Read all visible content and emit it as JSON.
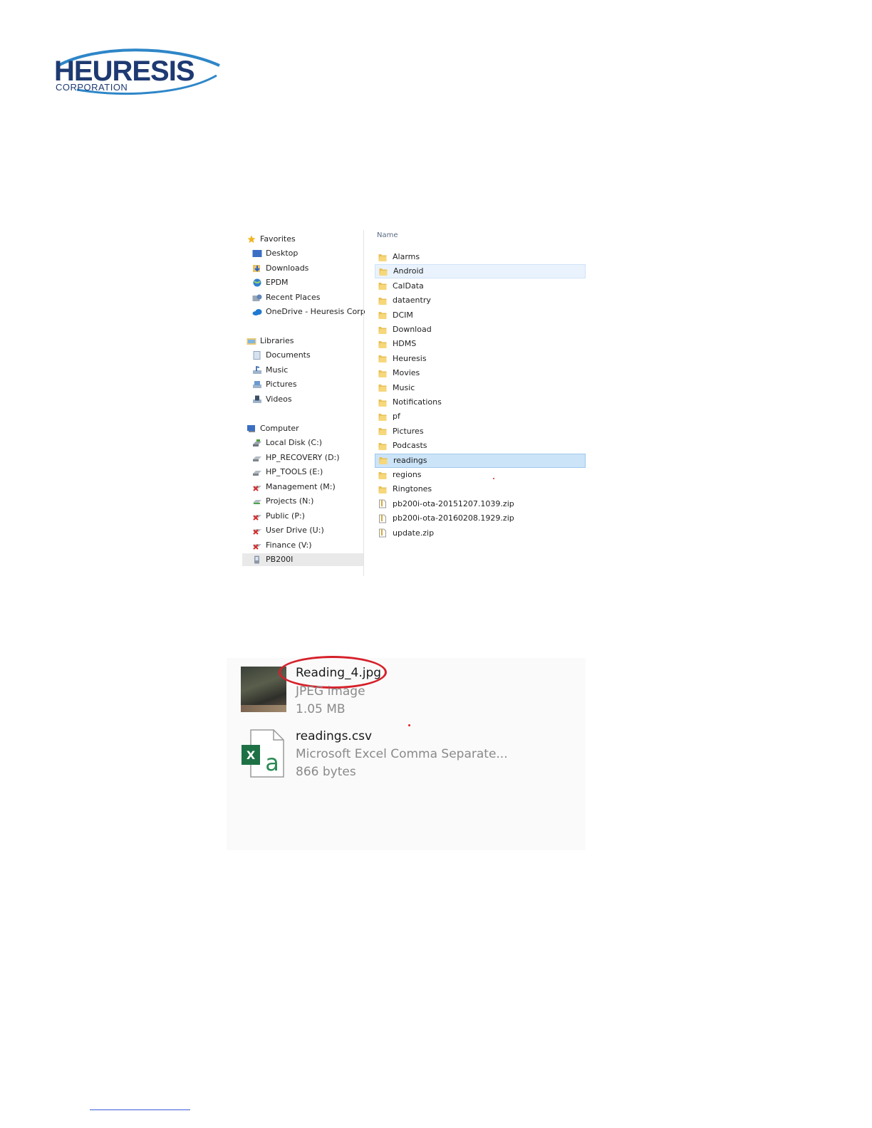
{
  "logo": {
    "name": "HEURESIS",
    "subtitle": "CORPORATION",
    "colors": {
      "text": "#1e3a72",
      "swoosh": "#2e86c8"
    }
  },
  "explorer": {
    "column_header": "Name",
    "nav": {
      "favorites": {
        "label": "Favorites",
        "items": [
          "Desktop",
          "Downloads",
          "EPDM",
          "Recent Places",
          "OneDrive - Heuresis Corp"
        ]
      },
      "libraries": {
        "label": "Libraries",
        "items": [
          "Documents",
          "Music",
          "Pictures",
          "Videos"
        ]
      },
      "computer": {
        "label": "Computer",
        "items": [
          "Local Disk (C:)",
          "HP_RECOVERY (D:)",
          "HP_TOOLS (E:)",
          "Management (M:)",
          "Projects (N:)",
          "Public (P:)",
          "User Drive (U:)",
          "Finance (V:)",
          "PB200I"
        ],
        "selected": "PB200I"
      }
    },
    "files": [
      {
        "name": "Alarms",
        "kind": "folder"
      },
      {
        "name": "Android",
        "kind": "folder",
        "state": "hover"
      },
      {
        "name": "CalData",
        "kind": "folder"
      },
      {
        "name": "dataentry",
        "kind": "folder"
      },
      {
        "name": "DCIM",
        "kind": "folder"
      },
      {
        "name": "Download",
        "kind": "folder"
      },
      {
        "name": "HDMS",
        "kind": "folder"
      },
      {
        "name": "Heuresis",
        "kind": "folder"
      },
      {
        "name": "Movies",
        "kind": "folder"
      },
      {
        "name": "Music",
        "kind": "folder"
      },
      {
        "name": "Notifications",
        "kind": "folder"
      },
      {
        "name": "pf",
        "kind": "folder"
      },
      {
        "name": "Pictures",
        "kind": "folder"
      },
      {
        "name": "Podcasts",
        "kind": "folder"
      },
      {
        "name": "readings",
        "kind": "folder",
        "state": "selected"
      },
      {
        "name": "regions",
        "kind": "folder"
      },
      {
        "name": "Ringtones",
        "kind": "folder"
      },
      {
        "name": "pb200i-ota-20151207.1039.zip",
        "kind": "zip"
      },
      {
        "name": "pb200i-ota-20160208.1929.zip",
        "kind": "zip"
      },
      {
        "name": "update.zip",
        "kind": "zip"
      }
    ]
  },
  "cards": [
    {
      "name": "Reading_4.jpg",
      "type": "JPEG image",
      "size": "1.05 MB",
      "icon": "photo-thumbnail",
      "highlighted": true
    },
    {
      "name": "readings.csv",
      "type": "Microsoft Excel Comma Separate...",
      "size": "866 bytes",
      "icon": "excel-icon"
    }
  ]
}
